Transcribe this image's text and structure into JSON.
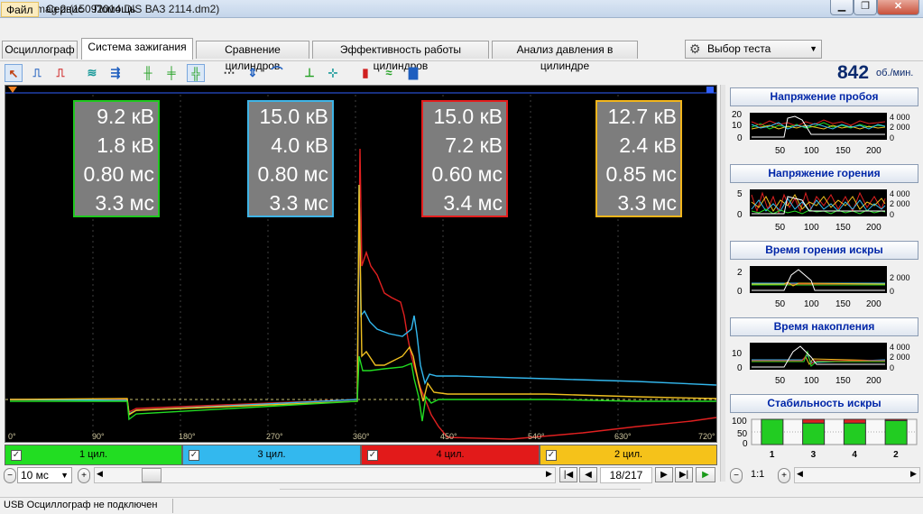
{
  "window": {
    "title": "Diamag 2 (15092014 DIS ВАЗ 2114.dm2)"
  },
  "menu": {
    "file": "Файл",
    "service": "Сервис",
    "help": "Помощь"
  },
  "tabs": [
    {
      "label": "Осциллограф"
    },
    {
      "label": "Система зажигания"
    },
    {
      "label": "Сравнение цилиндров"
    },
    {
      "label": "Эффективность работы цилиндров"
    },
    {
      "label": "Анализ давления в цилиндре"
    }
  ],
  "test_select": {
    "value": "Выбор теста"
  },
  "rpm": {
    "value": "842",
    "unit": "об./мин."
  },
  "scope": {
    "degree_ticks": [
      "0°",
      "90°",
      "180°",
      "270°",
      "360°",
      "450°",
      "540°",
      "630°",
      "720°"
    ],
    "boxes": [
      {
        "color": "#1fc81f",
        "lines": [
          "9.2 кВ",
          "1.8 кВ",
          "0.80 мс",
          "3.3 мс"
        ]
      },
      {
        "color": "#3fb4e6",
        "lines": [
          "15.0 кВ",
          "4.0 кВ",
          "0.80 мс",
          "3.3 мс"
        ]
      },
      {
        "color": "#e41e1e",
        "lines": [
          "15.0 кВ",
          "7.2 кВ",
          "0.60 мс",
          "3.4 мс"
        ]
      },
      {
        "color": "#f2b51c",
        "lines": [
          "12.7 кВ",
          "2.4 кВ",
          "0.85 мс",
          "3.3 мс"
        ]
      }
    ],
    "trace_colors": {
      "green": "#22dd22",
      "blue": "#33b8ee",
      "red": "#e02020",
      "yellow": "#f0c020"
    }
  },
  "cylinders": [
    {
      "label": "1 цил.",
      "color": "#22dd22",
      "checked": true
    },
    {
      "label": "3 цил.",
      "color": "#33b8ee",
      "checked": true
    },
    {
      "label": "4 цил.",
      "color": "#e21a1a",
      "checked": true
    },
    {
      "label": "2 цил.",
      "color": "#f5c21a",
      "checked": true
    }
  ],
  "bottom": {
    "time_scale": "10 мс",
    "frame": "18/217"
  },
  "right_panel": {
    "charts": [
      {
        "title": "Напряжение пробоя",
        "y_ticks": [
          "20",
          "10",
          "0"
        ],
        "rpm_ticks": [
          "4 000",
          "2 000",
          "0"
        ],
        "x_ticks": [
          "50",
          "100",
          "150",
          "200"
        ]
      },
      {
        "title": "Напряжение горения",
        "y_ticks": [
          "5",
          "0"
        ],
        "rpm_ticks": [
          "4 000",
          "2 000",
          "0"
        ],
        "x_ticks": [
          "50",
          "100",
          "150",
          "200"
        ]
      },
      {
        "title": "Время горения искры",
        "y_ticks": [
          "2",
          "0"
        ],
        "rpm_ticks": [
          "2 000",
          "0"
        ],
        "x_ticks": [
          "50",
          "100",
          "150",
          "200"
        ]
      },
      {
        "title": "Время накопления",
        "y_ticks": [
          "10",
          "0"
        ],
        "rpm_ticks": [
          "4 000",
          "2 000",
          "0"
        ],
        "x_ticks": [
          "50",
          "100",
          "150",
          "200"
        ]
      }
    ],
    "stability": {
      "title": "Стабильность искры",
      "y_ticks": [
        "100",
        "50",
        "0"
      ],
      "categories": [
        "1",
        "3",
        "4",
        "2"
      ],
      "values": [
        100,
        85,
        85,
        95
      ],
      "spark_defect": [
        0,
        15,
        15,
        5
      ]
    },
    "ratio": "1:1"
  },
  "status": {
    "text": "USB Осциллограф не подключен"
  }
}
